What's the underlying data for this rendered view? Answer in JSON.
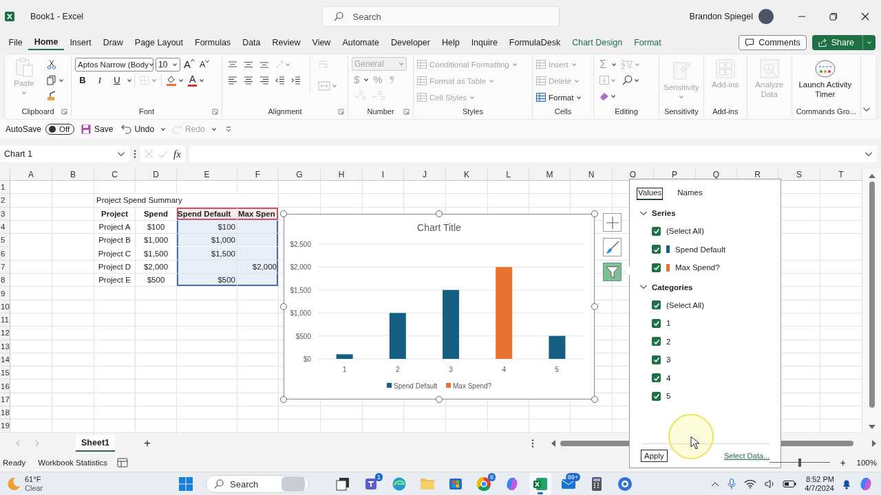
{
  "title_bar": {
    "title": "Book1 - Excel",
    "search_placeholder": "Search",
    "user": "Brandon Spiegel"
  },
  "menu": {
    "tabs": [
      {
        "label": "File",
        "selected": false,
        "kind": "standard"
      },
      {
        "label": "Home",
        "selected": true,
        "kind": "standard"
      },
      {
        "label": "Insert",
        "selected": false,
        "kind": "standard"
      },
      {
        "label": "Draw",
        "selected": false,
        "kind": "standard"
      },
      {
        "label": "Page Layout",
        "selected": false,
        "kind": "standard"
      },
      {
        "label": "Formulas",
        "selected": false,
        "kind": "standard"
      },
      {
        "label": "Data",
        "selected": false,
        "kind": "standard"
      },
      {
        "label": "Review",
        "selected": false,
        "kind": "standard"
      },
      {
        "label": "View",
        "selected": false,
        "kind": "standard"
      },
      {
        "label": "Automate",
        "selected": false,
        "kind": "standard"
      },
      {
        "label": "Developer",
        "selected": false,
        "kind": "standard"
      },
      {
        "label": "Help",
        "selected": false,
        "kind": "standard"
      },
      {
        "label": "Inquire",
        "selected": false,
        "kind": "standard"
      },
      {
        "label": "FormulaDesk",
        "selected": false,
        "kind": "standard"
      },
      {
        "label": "Chart Design",
        "selected": false,
        "kind": "contextual"
      },
      {
        "label": "Format",
        "selected": false,
        "kind": "contextual"
      }
    ],
    "comments": "Comments",
    "share": "Share"
  },
  "ribbon": {
    "groups": [
      {
        "kind": "clipboard",
        "label": "Clipboard",
        "paste": {
          "label": "Paste",
          "disabled": true
        }
      },
      {
        "kind": "font",
        "label": "Font",
        "font_name": "Aptos Narrow (Body",
        "font_size": "10",
        "grow": "A",
        "shrink": "A",
        "styles": [
          "B",
          "I",
          "U"
        ],
        "font_color": "A"
      },
      {
        "kind": "alignment",
        "label": "Alignment"
      },
      {
        "kind": "number",
        "label": "Number",
        "format": {
          "value": "General",
          "disabled": true
        },
        "currency": "$",
        "percent": "%"
      },
      {
        "kind": "styles",
        "label": "Styles",
        "items": [
          {
            "label": "Conditional Formatting",
            "disabled": true
          },
          {
            "label": "Format as Table",
            "disabled": true
          },
          {
            "label": "Cell Styles",
            "disabled": true
          }
        ]
      },
      {
        "kind": "cells",
        "label": "Cells",
        "items": [
          {
            "label": "Insert",
            "disabled": true
          },
          {
            "label": "Delete",
            "disabled": true
          },
          {
            "label": "Format",
            "disabled": false
          }
        ]
      },
      {
        "kind": "editing",
        "label": "Editing",
        "sum": "Σ"
      },
      {
        "kind": "sensitivity",
        "label": "Sensitivity",
        "button": {
          "label": "Sensitivity",
          "disabled": true
        }
      },
      {
        "kind": "addins",
        "label": "Add-ins",
        "button": {
          "label": "Add-ins",
          "disabled": true
        }
      },
      {
        "kind": "analyze",
        "button": {
          "label": "Analyze Data",
          "disabled": true
        }
      },
      {
        "kind": "timer",
        "label": "Commands Gro...",
        "button": {
          "label": "Launch Activity Timer",
          "disabled": false
        }
      }
    ]
  },
  "quick_access": {
    "autosave": {
      "label": "AutoSave",
      "on": false,
      "state_text": "Off"
    },
    "items": [
      {
        "label": "Save",
        "disabled": false,
        "kind": "save"
      },
      {
        "label": "Undo",
        "disabled": false,
        "kind": "undo"
      },
      {
        "label": "Redo",
        "disabled": true,
        "kind": "redo"
      }
    ]
  },
  "formula_bar": {
    "name_box": "Chart 1",
    "fx": "fx"
  },
  "sheet": {
    "columns": [
      "A",
      "B",
      "C",
      "D",
      "E",
      "F",
      "G",
      "H",
      "I",
      "J",
      "K",
      "L",
      "M",
      "N",
      "O",
      "P",
      "Q",
      "R",
      "S",
      "T"
    ],
    "row_numbers": [
      "1",
      "2",
      "3",
      "4",
      "5",
      "6",
      "7",
      "8",
      "9",
      "10",
      "11",
      "12",
      "13",
      "14",
      "15",
      "16",
      "17",
      "18",
      "19"
    ],
    "table": {
      "title": "Project Spend Summary",
      "header": [
        {
          "text": "Project",
          "selected": false
        },
        {
          "text": "Spend",
          "selected": false
        },
        {
          "text": "Spend Default",
          "selected": true
        },
        {
          "text": "Max Spen",
          "selected": true
        }
      ],
      "rows": [
        {
          "cells": [
            {
              "text": "Project A",
              "selected": false
            },
            {
              "text": "$100",
              "selected": false
            },
            {
              "text": "$100",
              "selected": true
            },
            {
              "selected": true
            }
          ]
        },
        {
          "cells": [
            {
              "text": "Project B",
              "selected": false
            },
            {
              "text": "$1,000",
              "selected": false
            },
            {
              "text": "$1,000",
              "selected": true
            },
            {
              "selected": true
            }
          ]
        },
        {
          "cells": [
            {
              "text": "Project C",
              "selected": false
            },
            {
              "text": "$1,500",
              "selected": false
            },
            {
              "text": "$1,500",
              "selected": true
            },
            {
              "selected": true
            }
          ]
        },
        {
          "cells": [
            {
              "text": "Project D",
              "selected": false
            },
            {
              "text": "$2,000",
              "selected": false
            },
            {
              "selected": true
            },
            {
              "text": "$2,000",
              "selected": true
            }
          ]
        },
        {
          "cells": [
            {
              "text": "Project E",
              "selected": false
            },
            {
              "text": "$500",
              "selected": false
            },
            {
              "text": "$500",
              "selected": true
            },
            {
              "selected": true
            }
          ]
        }
      ]
    }
  },
  "chart": {
    "chart_data": {
      "type": "bar",
      "title": "Chart Title",
      "categories": [
        "1",
        "2",
        "3",
        "4",
        "5"
      ],
      "series": [
        {
          "name": "Spend Default",
          "color": "#156082",
          "values": [
            100,
            1000,
            1500,
            null,
            500
          ]
        },
        {
          "name": "Max Spend?",
          "color": "#e97132",
          "values": [
            null,
            null,
            null,
            2000,
            null
          ]
        }
      ],
      "ylim": [
        0,
        2500
      ],
      "yticks": [
        {
          "value": 0,
          "label": "$0"
        },
        {
          "value": 500,
          "label": "$500"
        },
        {
          "value": 1000,
          "label": "$1,000"
        },
        {
          "value": 1500,
          "label": "$1,500"
        },
        {
          "value": 2000,
          "label": "$2,000"
        },
        {
          "value": 2500,
          "label": "$2,500"
        }
      ],
      "grid": true,
      "legend": true
    },
    "tools": [
      {
        "kind": "elements",
        "selected": false
      },
      {
        "kind": "styles",
        "selected": false
      },
      {
        "kind": "filters",
        "selected": true
      }
    ]
  },
  "filter_panel": {
    "tabs": [
      {
        "label": "Values",
        "selected": true
      },
      {
        "label": "Names",
        "selected": false
      }
    ],
    "sections": [
      {
        "title": "Series",
        "expanded": true,
        "items": [
          {
            "label": "(Select All)",
            "checked": true
          },
          {
            "label": "Spend Default",
            "checked": true,
            "color": "#156082"
          },
          {
            "label": "Max Spend?",
            "checked": true,
            "color": "#e97132"
          }
        ]
      },
      {
        "title": "Categories",
        "expanded": true,
        "items": [
          {
            "label": "(Select All)",
            "checked": true
          },
          {
            "label": "1",
            "checked": true
          },
          {
            "label": "2",
            "checked": true
          },
          {
            "label": "3",
            "checked": true
          },
          {
            "label": "4",
            "checked": true
          },
          {
            "label": "5",
            "checked": true
          }
        ]
      }
    ],
    "apply": "Apply",
    "link": "Select Data..."
  },
  "sheet_tabs": {
    "sheets": [
      {
        "label": "Sheet1",
        "selected": true
      }
    ],
    "add": "+"
  },
  "status_bar": {
    "mode": "Ready",
    "stats": "Workbook Statistics",
    "zoom": {
      "level": 0.5
    },
    "zoom_in": "+",
    "zoom_label": "100%"
  },
  "taskbar": {
    "weather": {
      "temperature": "61°F",
      "condition": "Clear"
    },
    "search_placeholder": "Search",
    "apps": [
      {
        "kind": "taskview",
        "active": false
      },
      {
        "kind": "chat",
        "badge": "1",
        "active": false
      },
      {
        "kind": "browser",
        "active": false
      },
      {
        "kind": "folder",
        "active": false
      },
      {
        "kind": "store",
        "active": false
      },
      {
        "kind": "browser2",
        "badge": "8",
        "active": false
      },
      {
        "kind": "copilot",
        "active": false
      },
      {
        "kind": "spreadsheet",
        "active": true
      },
      {
        "kind": "mail",
        "badge": "99+",
        "active": false
      },
      {
        "kind": "calculator",
        "active": false
      },
      {
        "kind": "app",
        "active": false
      }
    ],
    "time": "8:52 PM",
    "date": "4/7/2024"
  }
}
